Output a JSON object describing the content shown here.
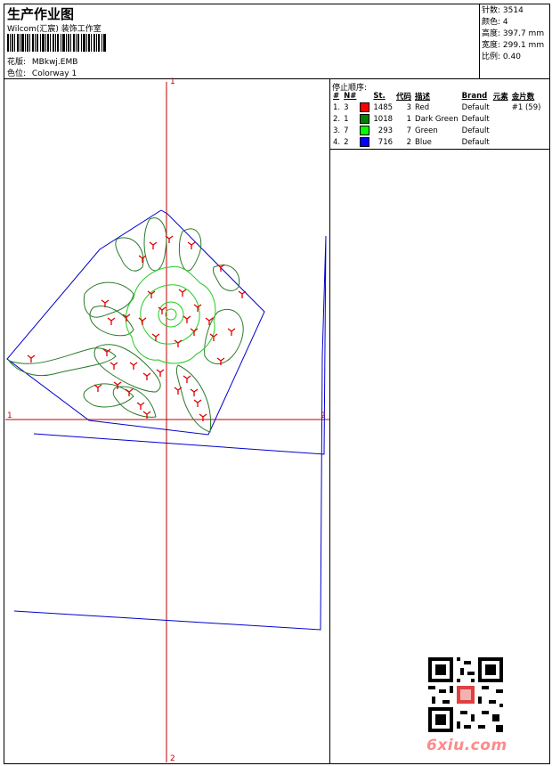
{
  "header": {
    "title": "生产作业图",
    "company": "Wilcom(汇宸) 装饰工作室",
    "design_label": "花版:",
    "design_value": "MBkwj.EMB",
    "colorway_label": "色位:",
    "colorway_value": "Colorway 1"
  },
  "stats": {
    "stitches_label": "针数:",
    "stitches_value": "3514",
    "colors_label": "颜色:",
    "colors_value": "4",
    "height_label": "高度:",
    "height_value": "397.7 mm",
    "width_label": "宽度:",
    "width_value": "299.1 mm",
    "scale_label": "比例:",
    "scale_value": "0.40"
  },
  "stop_sequence": {
    "title": "停止顺序:",
    "headers": [
      "#",
      "N#",
      "",
      "St.",
      "代码",
      "描述",
      "Brand",
      "元素",
      "金片数"
    ],
    "rows": [
      {
        "idx": "1.",
        "n": "3",
        "color": "#ff0000",
        "st": "1485",
        "code": "3",
        "desc": "Red",
        "brand": "Default",
        "elem": "",
        "seq": "#1 (59)"
      },
      {
        "idx": "2.",
        "n": "1",
        "color": "#008000",
        "st": "1018",
        "code": "1",
        "desc": "Dark Green",
        "brand": "Default",
        "elem": "",
        "seq": ""
      },
      {
        "idx": "3.",
        "n": "7",
        "color": "#00ff00",
        "st": "293",
        "code": "7",
        "desc": "Green",
        "brand": "Default",
        "elem": "",
        "seq": ""
      },
      {
        "idx": "4.",
        "n": "2",
        "color": "#0000ff",
        "st": "716",
        "code": "2",
        "desc": "Blue",
        "brand": "Default",
        "elem": "",
        "seq": ""
      }
    ]
  },
  "axis_labels": {
    "top": "1",
    "bottom": "2",
    "left": "1",
    "right": "2"
  },
  "colors": {
    "axis": "#c00000",
    "outline": "#0000cc",
    "dark_green": "#2a7a2a",
    "green": "#22cc22",
    "red": "#e00000"
  },
  "watermark": {
    "brand": "6xiu.com"
  }
}
